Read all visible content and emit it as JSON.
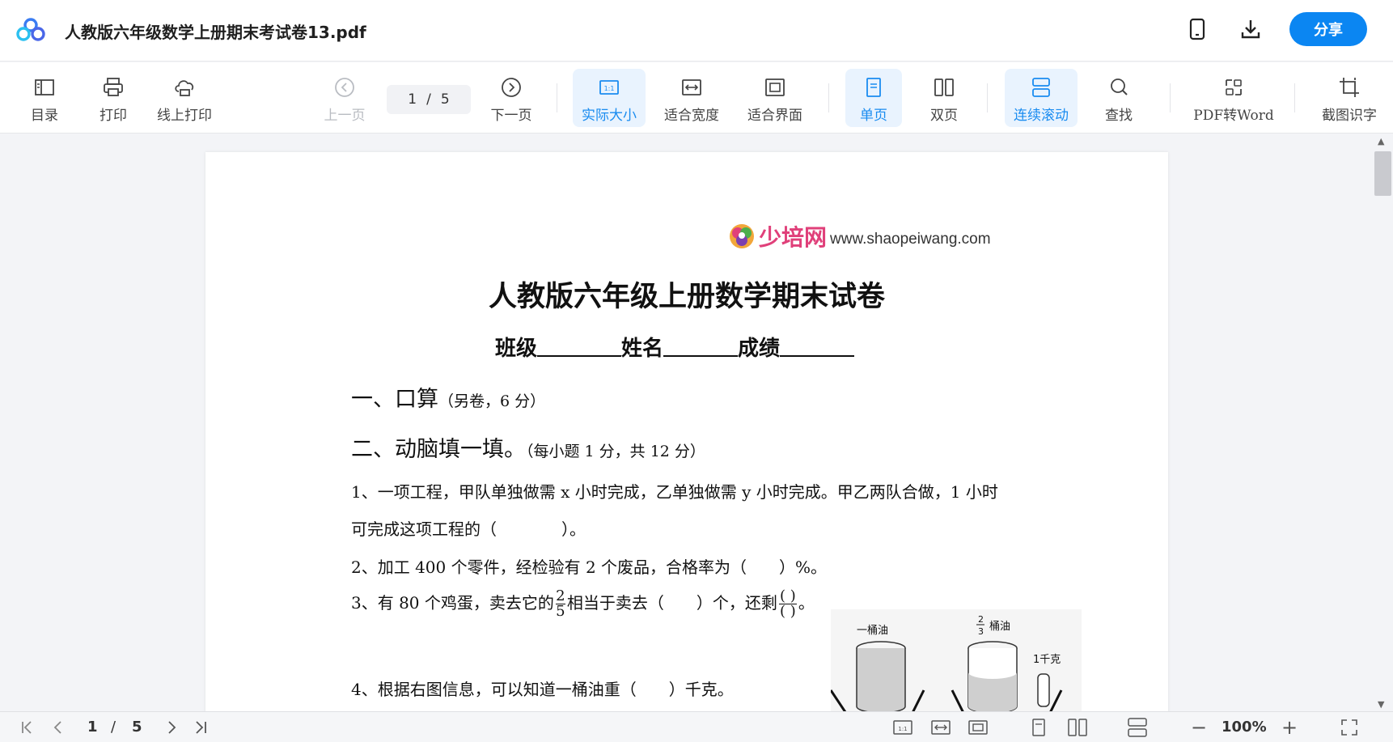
{
  "app": {
    "file_title": "人教版六年级数学上册期末考试卷13.pdf",
    "share_label": "分享"
  },
  "toolbar": {
    "toc": "目录",
    "print": "打印",
    "online_print": "线上打印",
    "prev_page": "上一页",
    "page_current": "1",
    "page_sep": "/",
    "page_total": "5",
    "next_page": "下一页",
    "actual_size": "实际大小",
    "fit_width": "适合宽度",
    "fit_screen": "适合界面",
    "single_page": "单页",
    "double_page": "双页",
    "continuous_scroll": "连续滚动",
    "search": "查找",
    "pdf_to_word": "PDF转Word",
    "screenshot_ocr": "截图识字"
  },
  "document": {
    "brand_name": "少培网",
    "brand_url": "www.shaopeiwang.com",
    "title": "人教版六年级上册数学期末试卷",
    "field_class": "班级",
    "field_name": "姓名",
    "field_score": "成绩",
    "sec1_title": "一、口算",
    "sec1_note": "（另卷，6 分）",
    "sec2_title": "二、动脑填一填。",
    "sec2_note": "（每小题 1 分，共 12 分）",
    "q1_line1": "1、一项工程，甲队单独做需 x 小时完成，乙单独做需 y 小时完成。甲乙两队合做，1 小时",
    "q1_line2": "可完成这项工程的（　　　　）。",
    "q2": "2、加工 400 个零件，经检验有 2 个废品，合格率为（　　）%。",
    "q3_part1": "3、有 80 个鸡蛋，卖去它的",
    "q3_frac_num": "2",
    "q3_frac_den": "5",
    "q3_part2": "相当于卖去（　　）个，还剩",
    "q3_frac2_num": "( )",
    "q3_frac2_den": "( )",
    "q3_end": "。",
    "q4": "4、根据右图信息，可以知道一桶油重（　　）千克。",
    "fig_label_left": "一桶油",
    "fig_label_right": "桶油",
    "fig_frac_num": "2",
    "fig_frac_den": "3",
    "fig_weight": "1千克"
  },
  "statusbar": {
    "page_current": "1",
    "page_sep": "/",
    "page_total": "5",
    "zoom": "100%"
  },
  "colors": {
    "accent": "#0b86f2",
    "active_bg": "#e9f3fe",
    "active_text": "#1a8cf0",
    "brand_pink": "#e0407a"
  }
}
